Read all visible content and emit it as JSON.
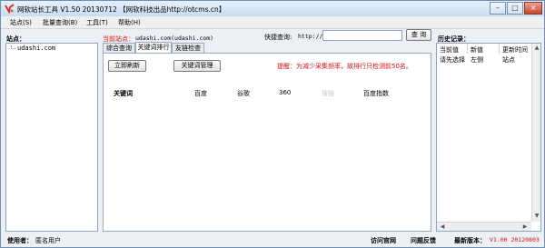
{
  "window": {
    "title": "网软站长工具 V1.50 20130712 【网软科技出品http://otcms.cn】",
    "minimize": "–",
    "maximize": "□",
    "close": "×"
  },
  "menu": [
    {
      "label": "站点(S)"
    },
    {
      "label": "批量查询(B)"
    },
    {
      "label": "工具(T)"
    },
    {
      "label": "帮助(H)"
    }
  ],
  "sites": {
    "heading": "站点：",
    "items": [
      {
        "label": "udashi.com"
      }
    ]
  },
  "current_site": {
    "label": "当前站点：",
    "value": "udashi.com(udashi.com)"
  },
  "quick_query": {
    "label": "快捷查询:",
    "prefix": "http://",
    "value": "",
    "button": "查 询"
  },
  "tabs": [
    {
      "label": "综合查询",
      "active": false
    },
    {
      "label": "关键词排行",
      "active": true
    },
    {
      "label": "友链检查",
      "active": false
    }
  ],
  "keyword_panel": {
    "refresh_button": "立即刷新",
    "manage_button": "关键词管理",
    "tip": "提醒：为减少采集频率，故排行只检测前50名。",
    "columns": [
      "关键词",
      "百度",
      "谷歌",
      "360",
      "搜搜",
      "百度指数"
    ],
    "column_colors": [
      "#000000",
      "#000000",
      "#000000",
      "#000000",
      "#c8c8c8",
      "#000000"
    ]
  },
  "history": {
    "heading": "历史记录：",
    "columns": [
      "当前值",
      "新值",
      "更新时间"
    ],
    "rows": [
      [
        "请先选择",
        "左侧",
        "站点"
      ]
    ]
  },
  "status": {
    "user_label": "使用者：",
    "user_value": "匿名用户",
    "visit_site": "访问官网",
    "feedback": "问题反馈",
    "version_label": "最新版本：",
    "version_value": "V1.00 20120803"
  },
  "colors": {
    "accent_red": "#d01010",
    "version_red": "#d01010",
    "border": "#8ea4c0"
  }
}
